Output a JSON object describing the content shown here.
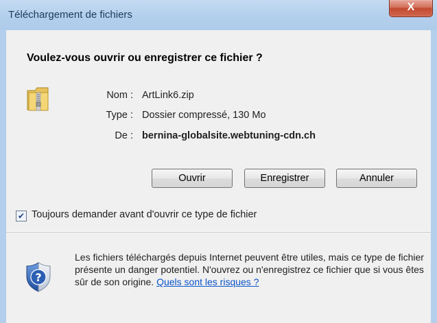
{
  "window": {
    "title": "Téléchargement de fichiers",
    "close_glyph": "X"
  },
  "dialog": {
    "question": "Voulez-vous ouvrir ou enregistrer ce fichier ?",
    "fields": [
      {
        "label": "Nom :",
        "value": "ArtLink6.zip"
      },
      {
        "label": "Type :",
        "value": "Dossier compressé, 130 Mo"
      },
      {
        "label": "De :",
        "value": "bernina-globalsite.webtuning-cdn.ch"
      }
    ],
    "buttons": {
      "open": "Ouvrir",
      "save": "Enregistrer",
      "cancel": "Annuler"
    },
    "checkbox": {
      "label": "Toujours demander avant d'ouvrir ce type de fichier",
      "checked": true
    },
    "warning": {
      "text": "Les fichiers téléchargés depuis Internet peuvent être utiles, mais ce type de fichier présente un danger potentiel. N'ouvrez ou n'enregistrez ce fichier que si vous êtes sûr de son origine. ",
      "link": "Quels sont les risques ?"
    }
  },
  "icons": {
    "file": "zip-folder-icon",
    "warning": "shield-question-icon",
    "close": "close-icon"
  },
  "colors": {
    "titlebar": "#b3cfec",
    "close_button": "#c9533a",
    "link": "#0b54c9",
    "background": "#f0f0f0"
  }
}
